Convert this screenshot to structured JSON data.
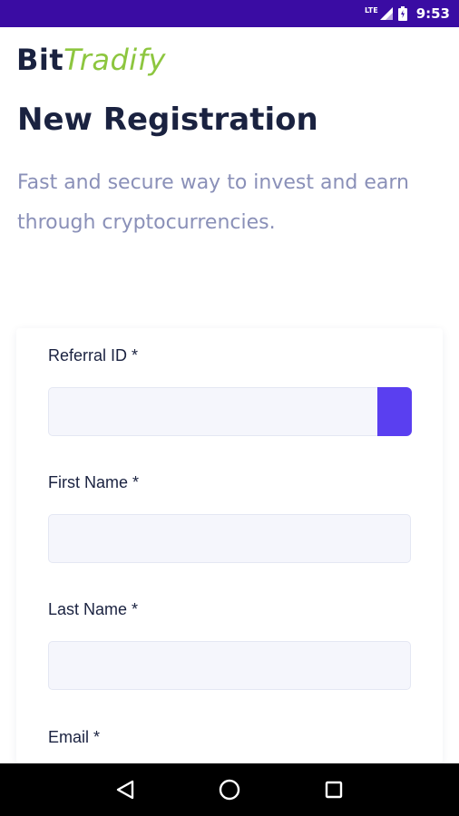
{
  "status_bar": {
    "network": "LTE",
    "time": "9:53"
  },
  "brand": {
    "name_part1": "Bit",
    "name_part2": "Tradify",
    "colors": {
      "dark": "#1a2240",
      "accent": "#8dc63f"
    }
  },
  "header": {
    "title": "New Registration",
    "subtitle": "Fast and secure way to invest and earn through cryptocurrencies."
  },
  "form": {
    "referral_id": {
      "label": "Referral ID *",
      "value": ""
    },
    "first_name": {
      "label": "First Name *",
      "value": ""
    },
    "last_name": {
      "label": "Last Name *",
      "value": ""
    },
    "email": {
      "label": "Email *",
      "value": ""
    }
  },
  "nav": {
    "back": "back-icon",
    "home": "home-icon",
    "recents": "recents-icon"
  },
  "colors": {
    "status_bar": "#3a0ca3",
    "primary_button": "#5a3ff0",
    "input_bg": "#f5f6fc",
    "subtitle_text": "#8a90b8"
  }
}
